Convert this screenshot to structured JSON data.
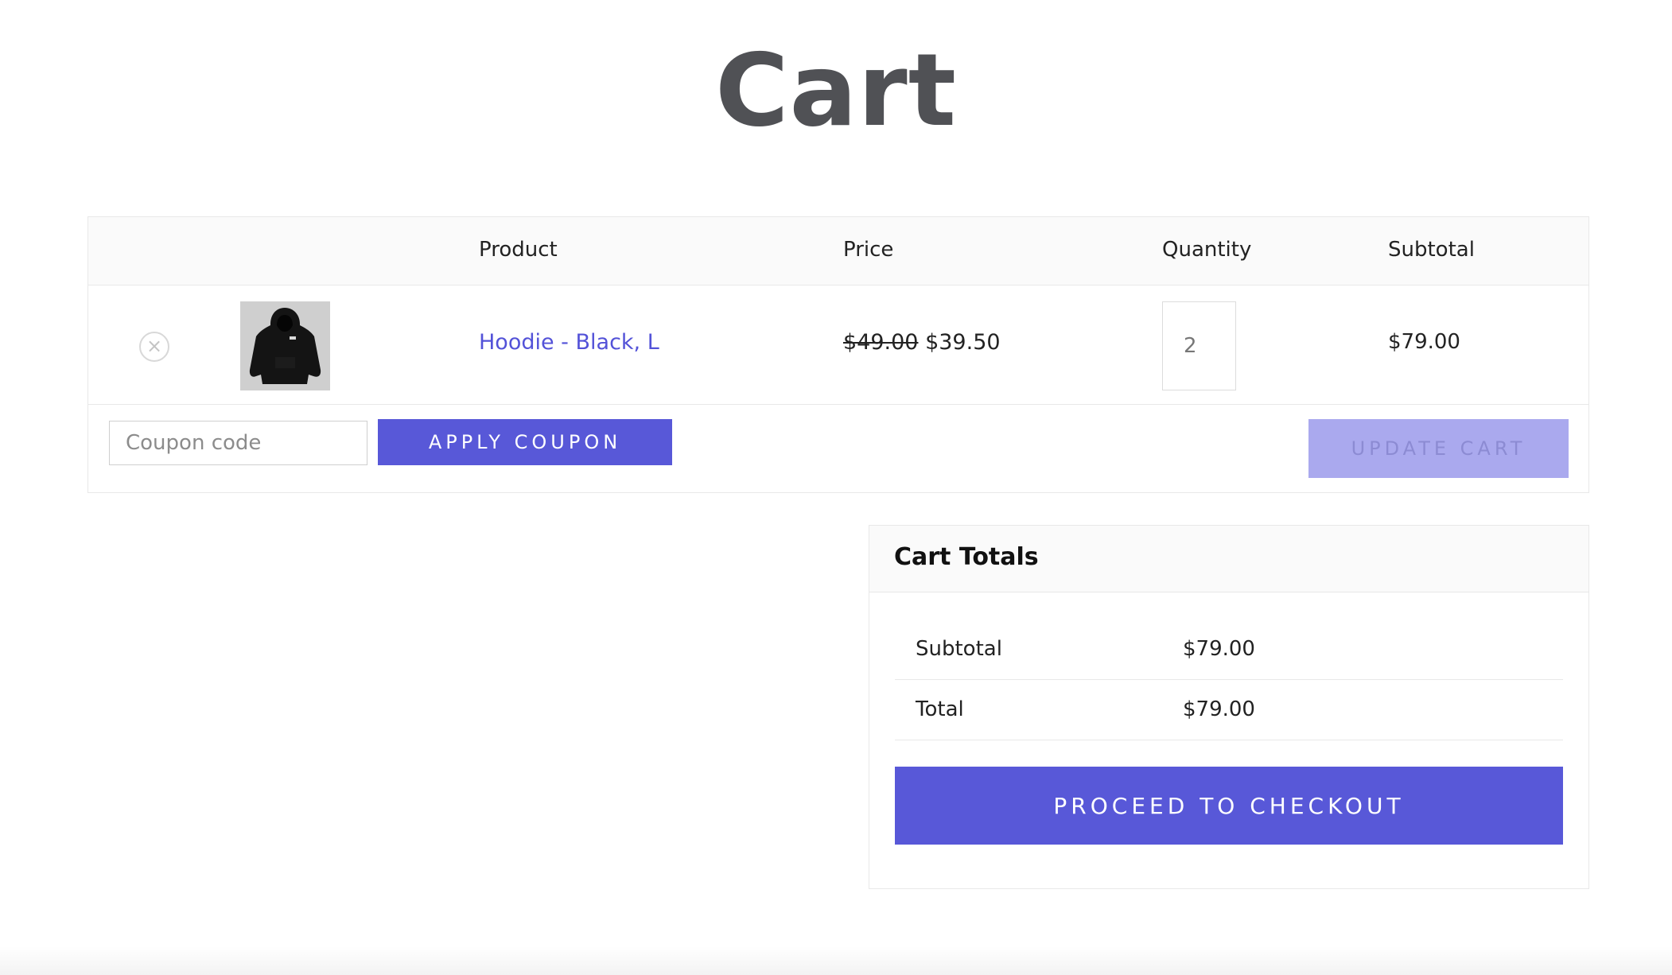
{
  "page": {
    "title": "Cart"
  },
  "cart_table": {
    "headers": {
      "product": "Product",
      "price": "Price",
      "quantity": "Quantity",
      "subtotal": "Subtotal"
    },
    "items": [
      {
        "name": "Hoodie - Black, L",
        "regular_price": "$49.00",
        "sale_price": "$39.50",
        "quantity": "2",
        "subtotal": "$79.00",
        "remove_icon": "×"
      }
    ],
    "coupon": {
      "placeholder": "Coupon code",
      "apply_label": "APPLY COUPON"
    },
    "update_label": "UPDATE CART"
  },
  "cart_totals": {
    "title": "Cart Totals",
    "subtotal_label": "Subtotal",
    "subtotal_value": "$79.00",
    "total_label": "Total",
    "total_value": "$79.00",
    "checkout_label": "PROCEED TO CHECKOUT"
  },
  "colors": {
    "accent": "#5858d8",
    "accent_disabled": "#aaa9ee",
    "link": "#5352d8",
    "title": "#505155",
    "header_bg": "#fafafa"
  }
}
